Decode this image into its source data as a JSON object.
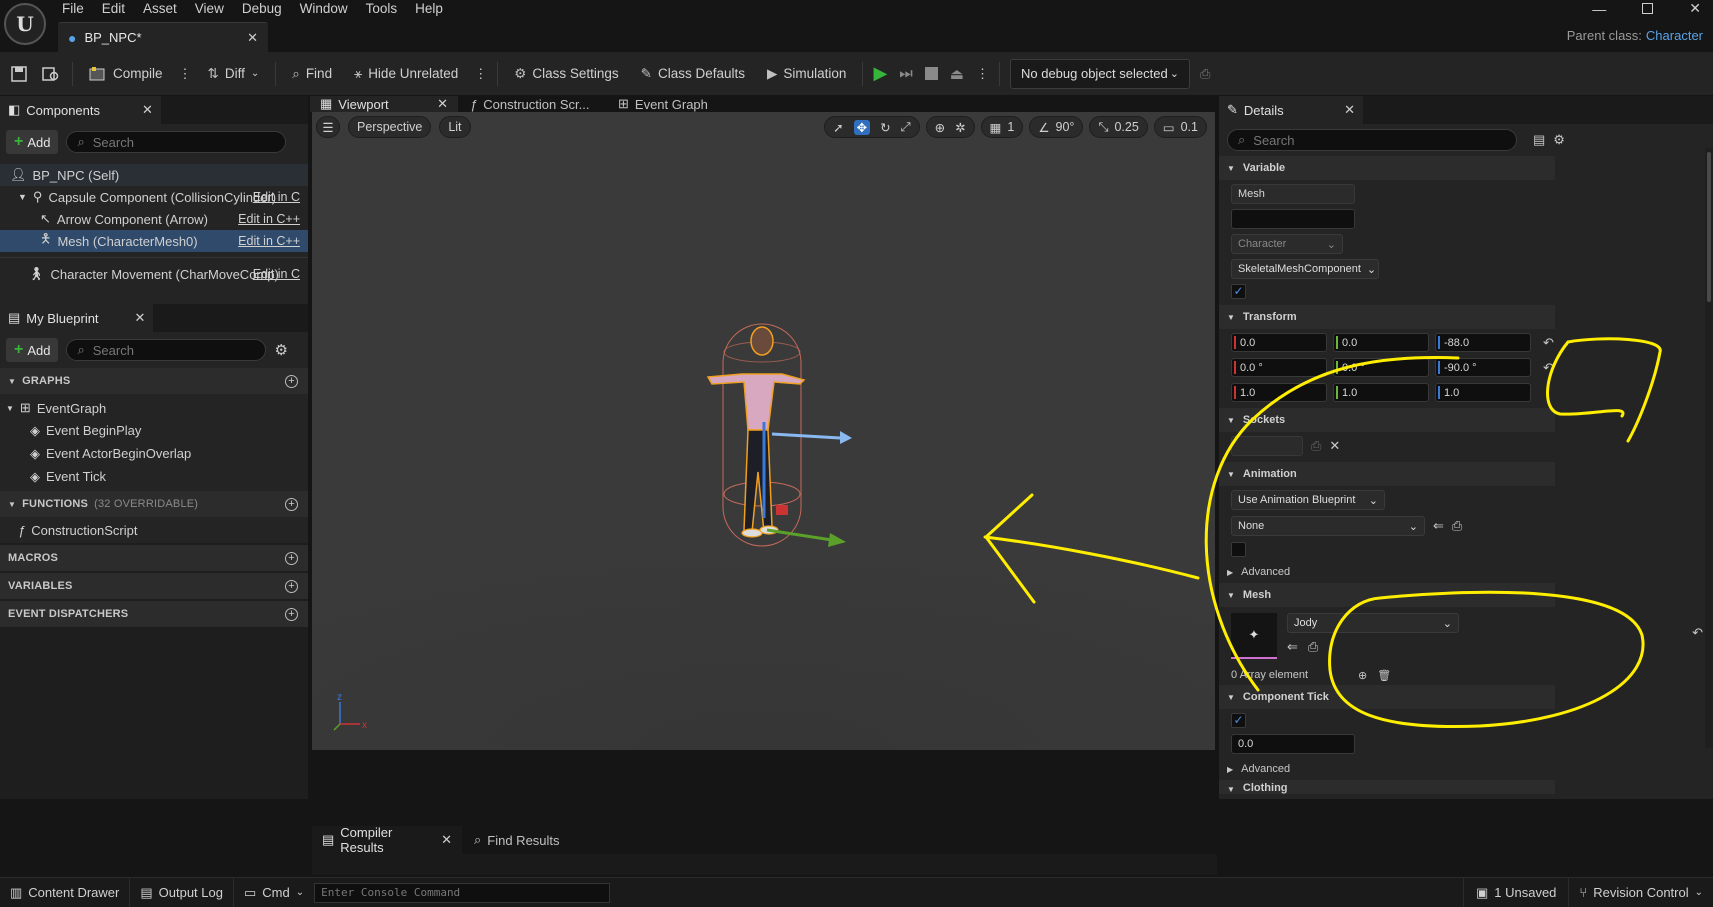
{
  "menubar": {
    "items": [
      "File",
      "Edit",
      "Asset",
      "View",
      "Debug",
      "Window",
      "Tools",
      "Help"
    ]
  },
  "doc_tab": {
    "name": "BP_NPC*"
  },
  "parent_class": {
    "label": "Parent class:",
    "value": "Character"
  },
  "toolbar": {
    "compile": "Compile",
    "diff": "Diff",
    "find": "Find",
    "hide_unrelated": "Hide Unrelated",
    "class_settings": "Class Settings",
    "class_defaults": "Class Defaults",
    "simulation": "Simulation",
    "debug_object": "No debug object selected"
  },
  "components": {
    "tab": "Components",
    "add": "Add",
    "search_placeholder": "Search",
    "items": [
      {
        "label": "BP_NPC (Self)",
        "action": ""
      },
      {
        "label": "Capsule Component (CollisionCylinder)",
        "action": "Edit in C"
      },
      {
        "label": "Arrow Component (Arrow)",
        "action": "Edit in C++"
      },
      {
        "label": "Mesh (CharacterMesh0)",
        "action": "Edit in C++"
      },
      {
        "label": "Character Movement (CharMoveComp)",
        "action": "Edit in C"
      }
    ]
  },
  "my_blueprint": {
    "tab": "My Blueprint",
    "add": "Add",
    "search_placeholder": "Search",
    "graphs_header": "GRAPHS",
    "event_graph": "EventGraph",
    "events": [
      "Event BeginPlay",
      "Event ActorBeginOverlap",
      "Event Tick"
    ],
    "functions_header": "FUNCTIONS",
    "functions_sub": "(32 OVERRIDABLE)",
    "construction_script": "ConstructionScript",
    "macros": "MACROS",
    "variables": "VARIABLES",
    "event_dispatchers": "EVENT DISPATCHERS"
  },
  "editor_tabs": {
    "viewport": "Viewport",
    "construction": "Construction Scr...",
    "event_graph": "Event Graph"
  },
  "viewport": {
    "perspective": "Perspective",
    "lit": "Lit",
    "grid_snap": "1",
    "angle_snap": "90°",
    "scale_snap": "0.25",
    "camera_speed": "0.1"
  },
  "details": {
    "tab": "Details",
    "search_placeholder": "Search",
    "variable_header": "Variable",
    "variable_name": "Mesh",
    "variable_class": "Character",
    "variable_type": "SkeletalMeshComponent",
    "transform_header": "Transform",
    "location": [
      "0.0",
      "0.0",
      "-88.0"
    ],
    "rotation": [
      "0.0 °",
      "0.0 °",
      "-90.0 °"
    ],
    "scale": [
      "1.0",
      "1.0",
      "1.0"
    ],
    "sockets_header": "Sockets",
    "animation_header": "Animation",
    "animation_mode": "Use Animation Blueprint",
    "anim_class": "None",
    "advanced": "Advanced",
    "mesh_header": "Mesh",
    "mesh_asset": "Jody",
    "array_element": "0 Array element",
    "component_tick_header": "Component Tick",
    "tick_interval": "0.0",
    "advanced2": "Advanced",
    "clothing_header": "Clothing"
  },
  "bottom_tabs": {
    "compiler_results": "Compiler Results",
    "find_results": "Find Results"
  },
  "statusbar": {
    "content_drawer": "Content Drawer",
    "output_log": "Output Log",
    "cmd": "Cmd",
    "console_placeholder": "Enter Console Command",
    "unsaved": "1 Unsaved",
    "revision_control": "Revision Control"
  },
  "colors": {
    "annotation": "#ffee00",
    "selection": "#2f4a6b",
    "link": "#5aa2e6",
    "play": "#36b53a"
  }
}
